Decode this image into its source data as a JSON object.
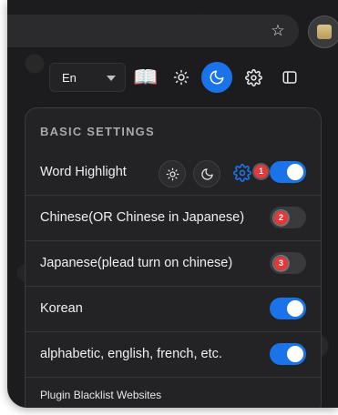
{
  "toolbar": {
    "language": "En",
    "icons": [
      "book-icon",
      "sun-icon",
      "moon-icon",
      "gear-icon",
      "sidebar-icon"
    ]
  },
  "panel": {
    "title": "BASIC SETTINGS",
    "rows": [
      {
        "label": "Word Highlight",
        "enabled": true,
        "badge": "1"
      },
      {
        "label": "Chinese(OR Chinese in Japanese)",
        "enabled": false,
        "badge": "2"
      },
      {
        "label": "Japanese(plead turn on chinese)",
        "enabled": false,
        "badge": "3"
      },
      {
        "label": "Korean",
        "enabled": true
      },
      {
        "label": "alphabetic, english, french, etc.",
        "enabled": true
      }
    ],
    "footer": "Plugin Blacklist Websites"
  },
  "colors": {
    "accent": "#1a73e8",
    "badge": "#e5383b",
    "background": "#1c1c1e",
    "panel": "#232325"
  }
}
